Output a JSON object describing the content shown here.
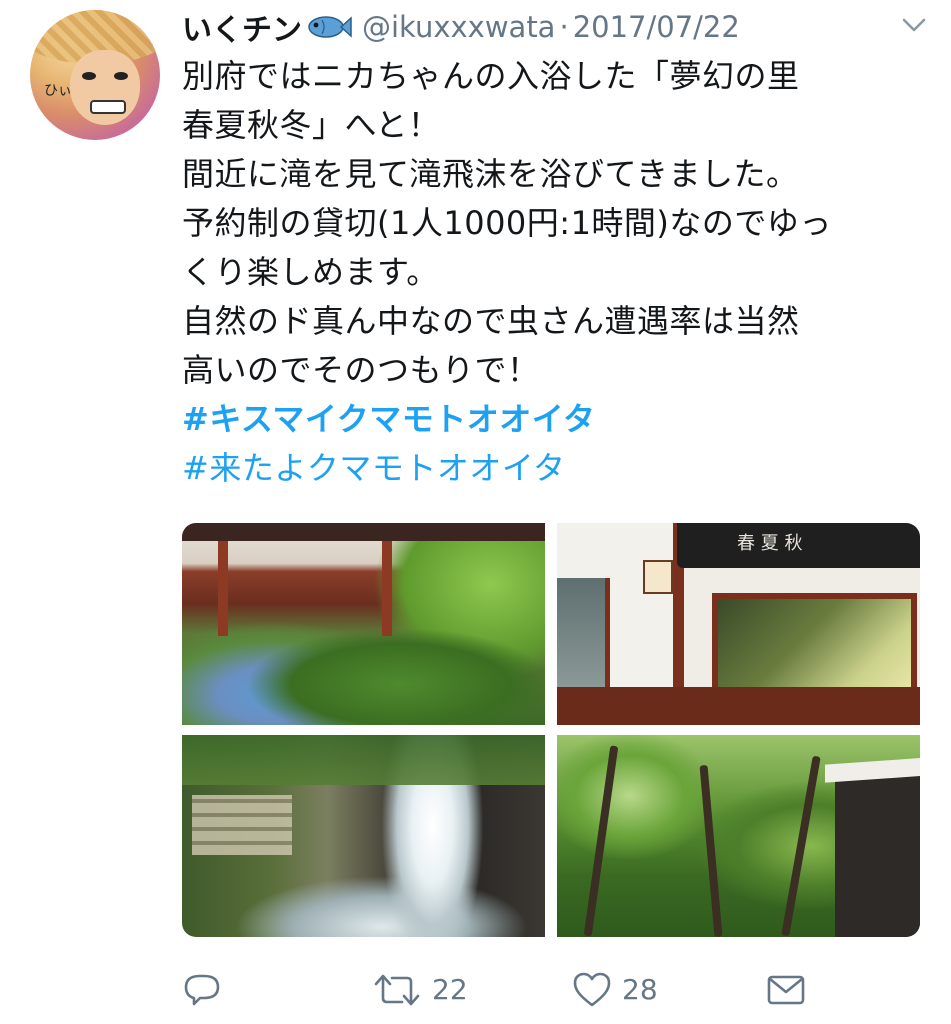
{
  "user": {
    "display_name": "いくチン",
    "handle": "@ikuxxxwata",
    "separator": "·",
    "date": "2017/07/22",
    "avatar_text": "ひぃ"
  },
  "tweet": {
    "lines": [
      "別府ではニカちゃんの入浴した「夢幻の里",
      "春夏秋冬」へと！",
      "間近に滝を見て滝飛沫を浴びてきました。",
      "予約制の貸切(1人1000円:1時間)なのでゆっ",
      "くり楽しめます。",
      "自然のド真ん中なので虫さん遭遇率は当然",
      "高いのでそのつもりで！"
    ],
    "hashtags": [
      "#キスマイクマモトオオイタ",
      "#来たよクマモトオオイタ"
    ]
  },
  "media": {
    "banner_text": "春 夏 秋"
  },
  "actions": {
    "reply_icon": "reply-icon",
    "retweet_icon": "retweet-icon",
    "retweet_count": "22",
    "like_icon": "heart-icon",
    "like_count": "28",
    "dm_icon": "envelope-icon"
  },
  "colors": {
    "text": "#14171a",
    "secondary": "#657786",
    "link": "#1da1f2"
  }
}
